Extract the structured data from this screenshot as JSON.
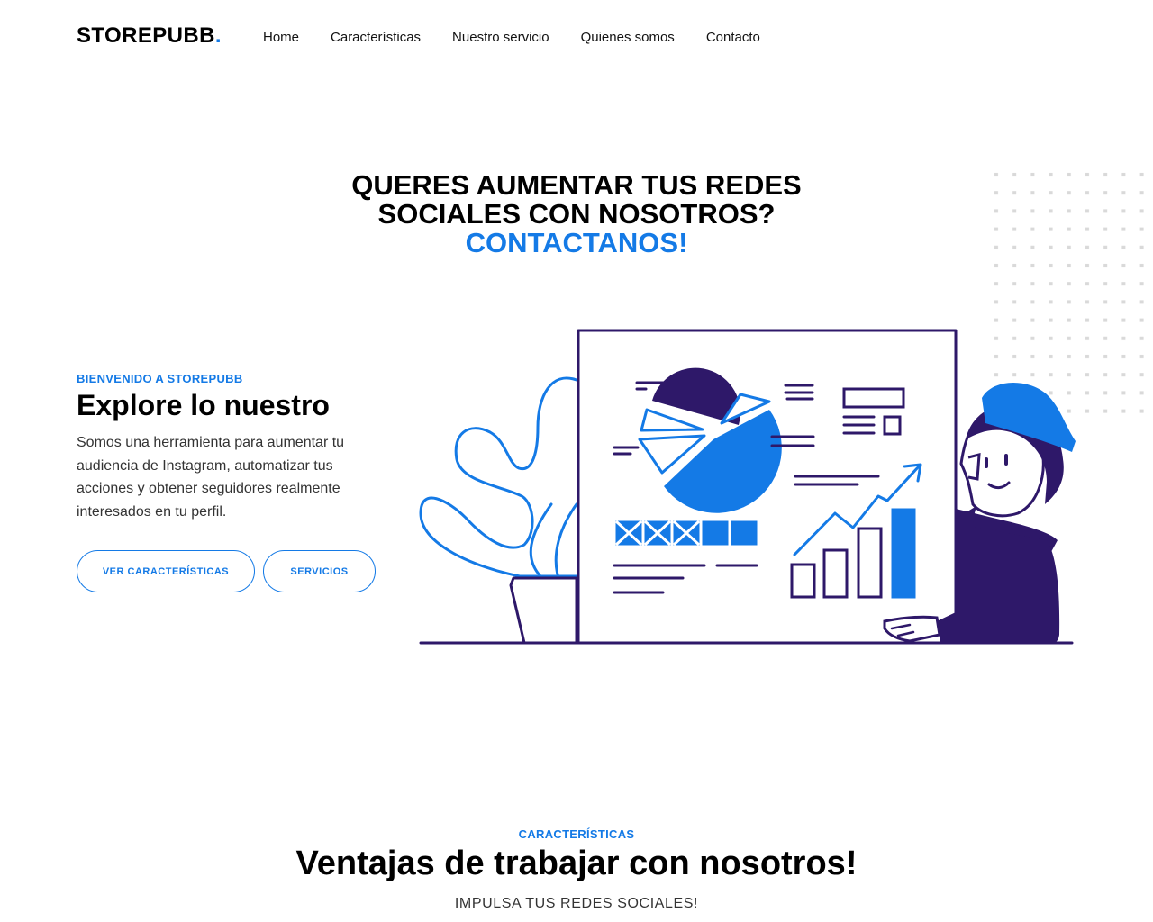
{
  "brand": {
    "name": "STOREPUBB",
    "dot": "."
  },
  "nav": [
    {
      "label": "Home"
    },
    {
      "label": "Características"
    },
    {
      "label": "Nuestro servicio"
    },
    {
      "label": "Quienes somos"
    },
    {
      "label": "Contacto"
    }
  ],
  "hero": {
    "line1": "QUERES AUMENTAR TUS REDES",
    "line2": "SOCIALES CON NOSOTROS?",
    "accent": "CONTACTANOS!"
  },
  "intro": {
    "eyebrow": "BIENVENIDO A STOREPUBB",
    "title": "Explore lo nuestro",
    "description": "Somos una herramienta para aumentar tu audiencia de Instagram, automatizar tus acciones y obtener seguidores realmente interesados en tu perfil.",
    "buttons": [
      {
        "label": "VER CARACTERÍSTICAS"
      },
      {
        "label": "SERVICIOS"
      }
    ]
  },
  "features": {
    "eyebrow": "CARACTERÍSTICAS",
    "title": "Ventajas de trabajar con nosotros!",
    "subtitle": "IMPULSA TUS REDES SOCIALES!"
  },
  "colors": {
    "accent": "#147ae6",
    "dark_purple": "#2e1869",
    "text": "#000000"
  },
  "icons": {
    "illustration": "analytics-illustration",
    "pattern": "dot-grid-pattern"
  }
}
